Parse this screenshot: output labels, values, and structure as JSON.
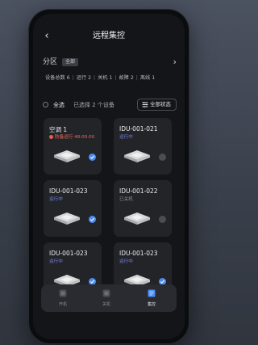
{
  "header": {
    "back_icon": "chevron-left-icon",
    "title": "远程集控"
  },
  "zone": {
    "label": "分区",
    "tag": "全部",
    "arrow_icon": "chevron-right-icon"
  },
  "stats": {
    "total": "设备总数 6",
    "running": "运行 2",
    "off": "关机 1",
    "fault": "故障 2",
    "offline": "离线 1",
    "separator": "|"
  },
  "selection": {
    "all_label": "全选",
    "selected_text": "已选择 2 个设备",
    "status_button": "全部状态",
    "status_icon": "filter-icon"
  },
  "devices": [
    {
      "name": "空调 1",
      "status": "防备运行 48:00:00",
      "status_kind": "fault",
      "selected": true
    },
    {
      "name": "IDU-001-021",
      "status": "运行中",
      "status_kind": "running",
      "selected": false
    },
    {
      "name": "IDU-001-023",
      "status": "运行中",
      "status_kind": "running",
      "selected": true
    },
    {
      "name": "IDU-001-022",
      "status": "已关机",
      "status_kind": "off",
      "selected": false
    },
    {
      "name": "IDU-001-023",
      "status": "运行中",
      "status_kind": "running",
      "selected": false
    },
    {
      "name": "IDU-001-023",
      "status": "运行中",
      "status_kind": "running",
      "selected": false
    }
  ],
  "tabs": [
    {
      "label": "开机",
      "icon": "power-on-icon",
      "active": false
    },
    {
      "label": "关机",
      "icon": "power-off-icon",
      "active": false
    },
    {
      "label": "集控",
      "icon": "group-control-icon",
      "active": true
    }
  ],
  "colors": {
    "accent": "#4a8df2",
    "running": "#7a86e8",
    "fault": "#ef6a57",
    "card": "#232428",
    "screen": "#141518"
  }
}
